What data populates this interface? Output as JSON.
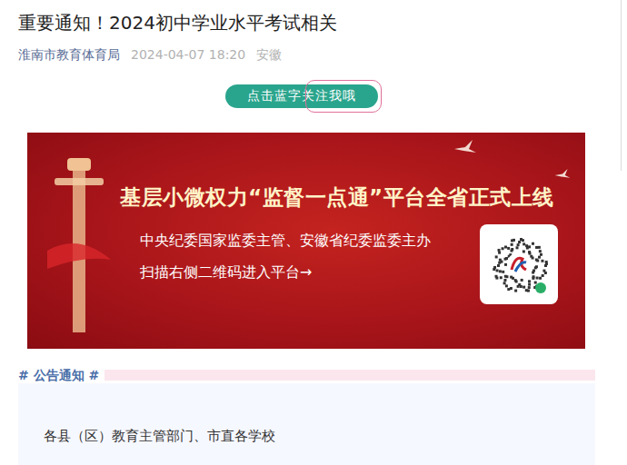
{
  "article": {
    "title": "重要通知！2024初中学业水平考试相关",
    "author": "淮南市教育体育局",
    "time": "2024-04-07 18:20",
    "location": "安徽"
  },
  "follow_button": {
    "label": "点击蓝字关注我哦",
    "highlighted": true
  },
  "banner": {
    "headline": "基层小微权力“监督一点通”平台全省正式上线",
    "lines": [
      "中央纪委国家监委主管、安徽省纪委监委主办",
      "扫描右侧二维码进入平台→"
    ]
  },
  "section": {
    "title": "# 公告通知 #",
    "body": "各县（区）教育主管部门、市直各学校"
  }
}
